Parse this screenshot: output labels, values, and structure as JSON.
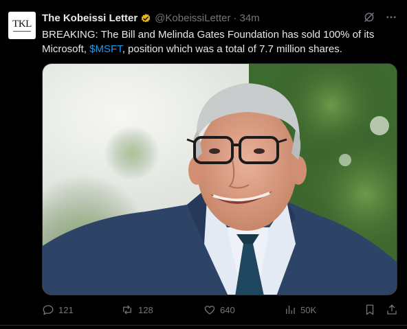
{
  "author": {
    "avatar_text": "TKL",
    "name": "The Kobeissi Letter",
    "handle": "@KobeissiLetter",
    "separator": "·",
    "time": "34m"
  },
  "tweet": {
    "text_before": "BREAKING: The Bill and Melinda Gates Foundation has sold 100% of its Microsoft, ",
    "cashtag": "$MSFT",
    "text_after": ", position which was a total of 7.7 million shares."
  },
  "actions": {
    "replies": "121",
    "reposts": "128",
    "likes": "640",
    "views": "50K"
  },
  "icons": {
    "verified": "verified-badge-icon",
    "grok": "grok-icon",
    "more": "more-icon",
    "reply": "reply-icon",
    "repost": "repost-icon",
    "like": "like-icon",
    "views": "views-icon",
    "bookmark": "bookmark-icon",
    "share": "share-icon"
  },
  "colors": {
    "background": "#000000",
    "text": "#e7e9ea",
    "muted": "#71767b",
    "link": "#1d9bf0",
    "verified": "#e2b719"
  }
}
